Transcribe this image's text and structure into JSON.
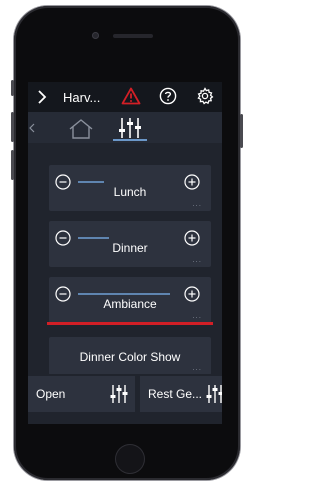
{
  "header": {
    "title": "Harv...",
    "back_icon": "chevron-right-icon",
    "warning_icon": "warning-triangle-icon",
    "help_icon": "question-circle-icon",
    "settings_icon": "gear-icon"
  },
  "tabs": [
    {
      "icon": "home-icon",
      "active": false
    },
    {
      "icon": "sliders-icon",
      "active": true
    }
  ],
  "scenes": [
    {
      "label": "Lunch",
      "level": 0.25,
      "more": "..."
    },
    {
      "label": "Dinner",
      "level": 0.3,
      "more": "..."
    },
    {
      "label": "Ambiance",
      "level": 0.88,
      "more": "...",
      "active": true
    }
  ],
  "color_show": {
    "label": "Dinner Color Show",
    "more": "..."
  },
  "bottom_buttons": [
    {
      "label": "Open",
      "icon": "sliders-icon"
    },
    {
      "label": "Rest Ge...",
      "icon": "sliders-icon"
    }
  ],
  "colors": {
    "accent": "#6b97c8",
    "active_underline": "#d21f26",
    "warning": "#d21f26",
    "card": "#2d323e",
    "background": "#20242d"
  }
}
